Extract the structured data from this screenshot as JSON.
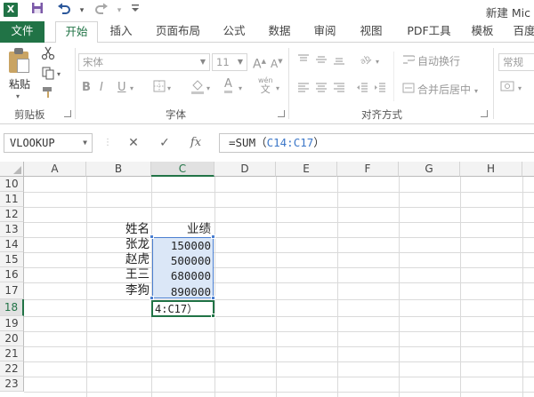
{
  "window": {
    "app_logo": "X",
    "title": "新建 Mic",
    "quick_access": [
      "save-icon",
      "undo-icon",
      "redo-icon",
      "customize-icon"
    ]
  },
  "tabs": {
    "file": "文件",
    "items": [
      "开始",
      "插入",
      "页面布局",
      "公式",
      "数据",
      "审阅",
      "视图",
      "PDF工具",
      "模板",
      "百度"
    ],
    "active": "开始"
  },
  "ribbon": {
    "clipboard": {
      "paste": "粘贴",
      "group": "剪贴板"
    },
    "font": {
      "name_placeholder": "宋体",
      "size_placeholder": "11",
      "grow": "A",
      "shrink": "A",
      "bold": "B",
      "italic": "I",
      "underline": "U",
      "color_letter": "A",
      "phonetic": "wén",
      "group": "字体"
    },
    "alignment": {
      "wrap_text": "自动换行",
      "merge_center": "合并后居中",
      "group": "对齐方式"
    },
    "number": {
      "format": "常规"
    },
    "accent_color": "#217346",
    "disabled_color": "#9c9c9c"
  },
  "formula_bar": {
    "name_box": "VLOOKUP",
    "cancel_glyph": "✕",
    "enter_glyph": "✓",
    "fx": "fx",
    "formula_prefix": "=SUM（",
    "formula_ref": "C14:C17",
    "formula_suffix": "）"
  },
  "sheet": {
    "columns": [
      "A",
      "B",
      "C",
      "D",
      "E",
      "F",
      "G",
      "H"
    ],
    "selected_column": "C",
    "rows": [
      "10",
      "11",
      "12",
      "13",
      "14",
      "15",
      "16",
      "17",
      "18",
      "19",
      "20",
      "21",
      "22",
      "23"
    ],
    "selected_row": "18",
    "header_row": {
      "name": "姓名",
      "score": "业绩"
    },
    "records": [
      {
        "name": "张龙",
        "score": "150000"
      },
      {
        "name": "赵虎",
        "score": "500000"
      },
      {
        "name": "王三",
        "score": "680000"
      },
      {
        "name": "李狗",
        "score": "890000"
      }
    ],
    "editing_text": "4:C17）",
    "range_color": "#4b7fd0",
    "range_fill": "#dbe7f7"
  }
}
